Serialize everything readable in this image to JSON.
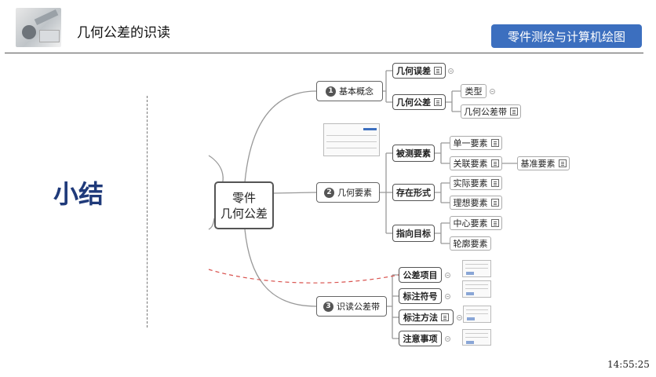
{
  "header": {
    "title": "几何公差的识读",
    "button_label": "零件测绘与计算机绘图"
  },
  "side_label": "小结",
  "timestamp": "14:55:25",
  "mindmap": {
    "root": {
      "line1": "零件",
      "line2": "几何公差"
    },
    "branch1": {
      "num": "1",
      "label": "基本概念",
      "c1": "几何误差",
      "c2": "几何公差",
      "c2a": "类型",
      "c2b": "几何公差带"
    },
    "branch2": {
      "num": "2",
      "label": "几何要素",
      "g1": "被测要素",
      "g1a": "单一要素",
      "g1b": "关联要素",
      "g1b1": "基准要素",
      "g2": "存在形式",
      "g2a": "实际要素",
      "g2b": "理想要素",
      "g3": "指向目标",
      "g3a": "中心要素",
      "g3b": "轮廓要素"
    },
    "branch3": {
      "num": "3",
      "label": "识读公差带",
      "c1": "公差项目",
      "c2": "标注符号",
      "c3": "标注方法",
      "c4": "注意事项"
    }
  },
  "colors": {
    "accent": "#3c6fbf",
    "title_blue": "#1f3a7a",
    "red_dash": "#d9534f"
  }
}
